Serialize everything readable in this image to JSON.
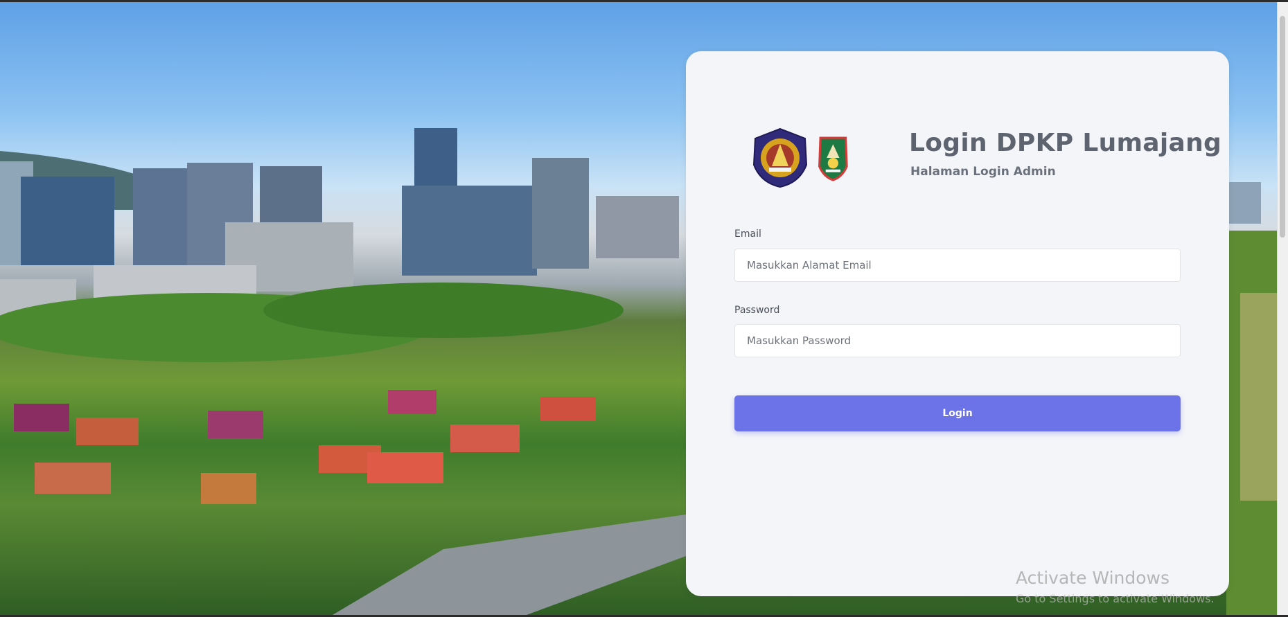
{
  "login": {
    "title": "Login DPKP Lumajang",
    "subtitle": "Halaman Login Admin",
    "email_label": "Email",
    "email_placeholder": "Masukkan Alamat Email",
    "password_label": "Password",
    "password_placeholder": "Masukkan Password",
    "submit_label": "Login"
  },
  "logos": [
    "emblem-east-java-icon",
    "emblem-lumajang-icon"
  ],
  "watermark": {
    "title": "Activate Windows",
    "subtitle": "Go to Settings to activate Windows."
  },
  "colors": {
    "button": "#6c72e8",
    "card": "#f4f5f8",
    "title": "#5d6470"
  }
}
